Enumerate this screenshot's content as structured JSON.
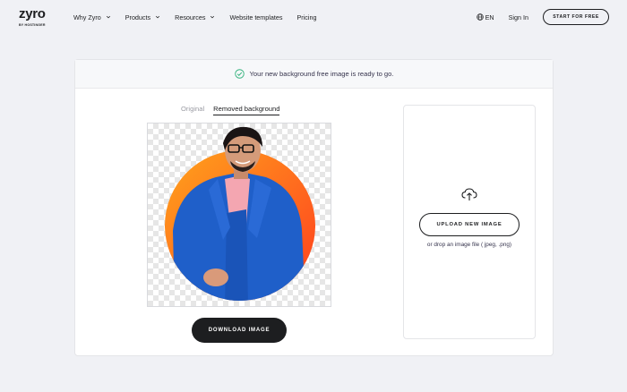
{
  "header": {
    "logo_word": "zyro",
    "logo_by": "BY HOSTINGER",
    "nav": [
      {
        "label": "Why Zyro",
        "has_dropdown": true
      },
      {
        "label": "Products",
        "has_dropdown": true
      },
      {
        "label": "Resources",
        "has_dropdown": true
      },
      {
        "label": "Website templates",
        "has_dropdown": false
      },
      {
        "label": "Pricing",
        "has_dropdown": false
      }
    ],
    "language": "EN",
    "signin": "Sign In",
    "cta": "START FOR FREE"
  },
  "banner": {
    "message": "Your new background free image is ready to go.",
    "icon": "check-circle-icon",
    "accent": "#36b37e"
  },
  "tabs": [
    {
      "label": "Original",
      "active": false
    },
    {
      "label": "Removed background",
      "active": true
    }
  ],
  "preview": {
    "subject": "person-in-blue-suit",
    "circle_colors": [
      "#ff9a1a",
      "#ff4a1f"
    ]
  },
  "download_label": "DOWNLOAD IMAGE",
  "upload": {
    "button_label": "UPLOAD NEW IMAGE",
    "hint": "or drop an image file ( jpeg, .png)"
  }
}
